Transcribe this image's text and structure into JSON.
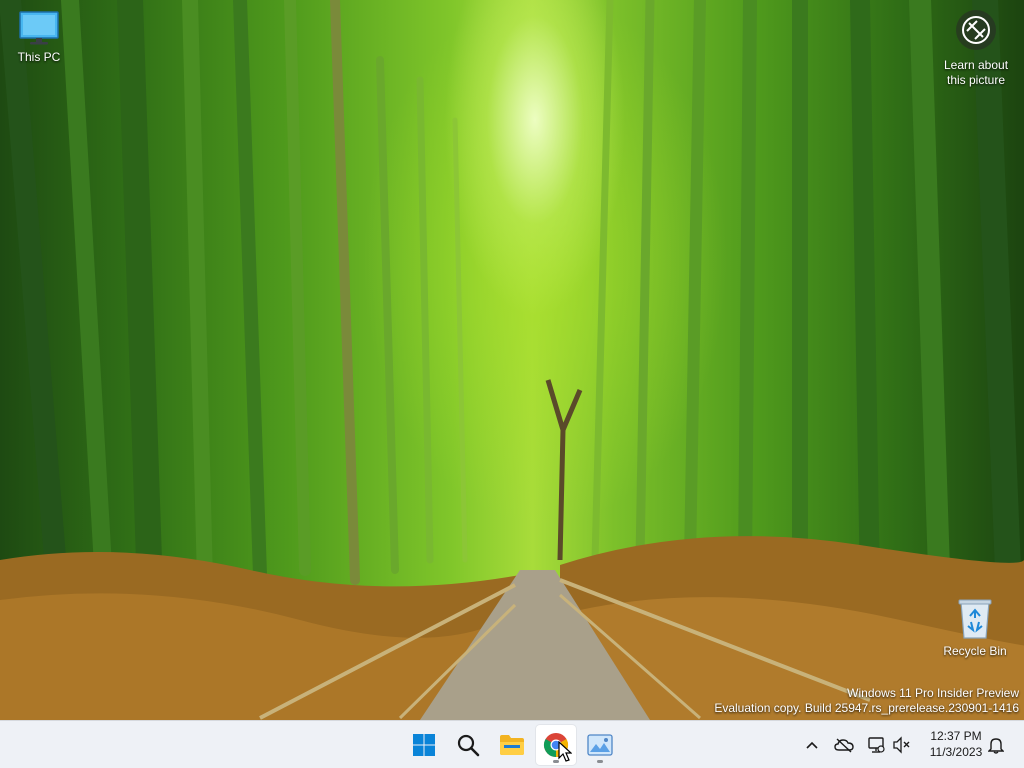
{
  "desktop": {
    "icons": [
      {
        "label": "This PC",
        "icon": "monitor-icon"
      },
      {
        "label": "Recycle Bin",
        "icon": "recycle-bin-icon"
      }
    ],
    "spotlight": {
      "label_line1": "Learn about",
      "label_line2": "this picture",
      "icon": "camera-aperture-icon"
    },
    "watermark": {
      "line1": "Windows 11 Pro Insider Preview",
      "line2": "Evaluation copy. Build 25947.rs_prerelease.230901-1416"
    }
  },
  "taskbar": {
    "apps": [
      {
        "name": "Start",
        "icon": "windows-start-icon"
      },
      {
        "name": "Search",
        "icon": "search-icon"
      },
      {
        "name": "File Explorer",
        "icon": "folder-icon"
      },
      {
        "name": "Google Chrome",
        "icon": "chrome-icon",
        "active": true
      },
      {
        "name": "Photos",
        "icon": "photos-icon",
        "running": true
      }
    ],
    "tray": {
      "icons": [
        "chevron-up-icon",
        "onedrive-offline-icon",
        "network-icon",
        "volume-muted-icon",
        "notification-bell-icon"
      ],
      "time": "12:37 PM",
      "date": "11/3/2023"
    }
  },
  "colors": {
    "taskbar_bg": "#eef1f6",
    "windows_blue": "#0078d4"
  }
}
